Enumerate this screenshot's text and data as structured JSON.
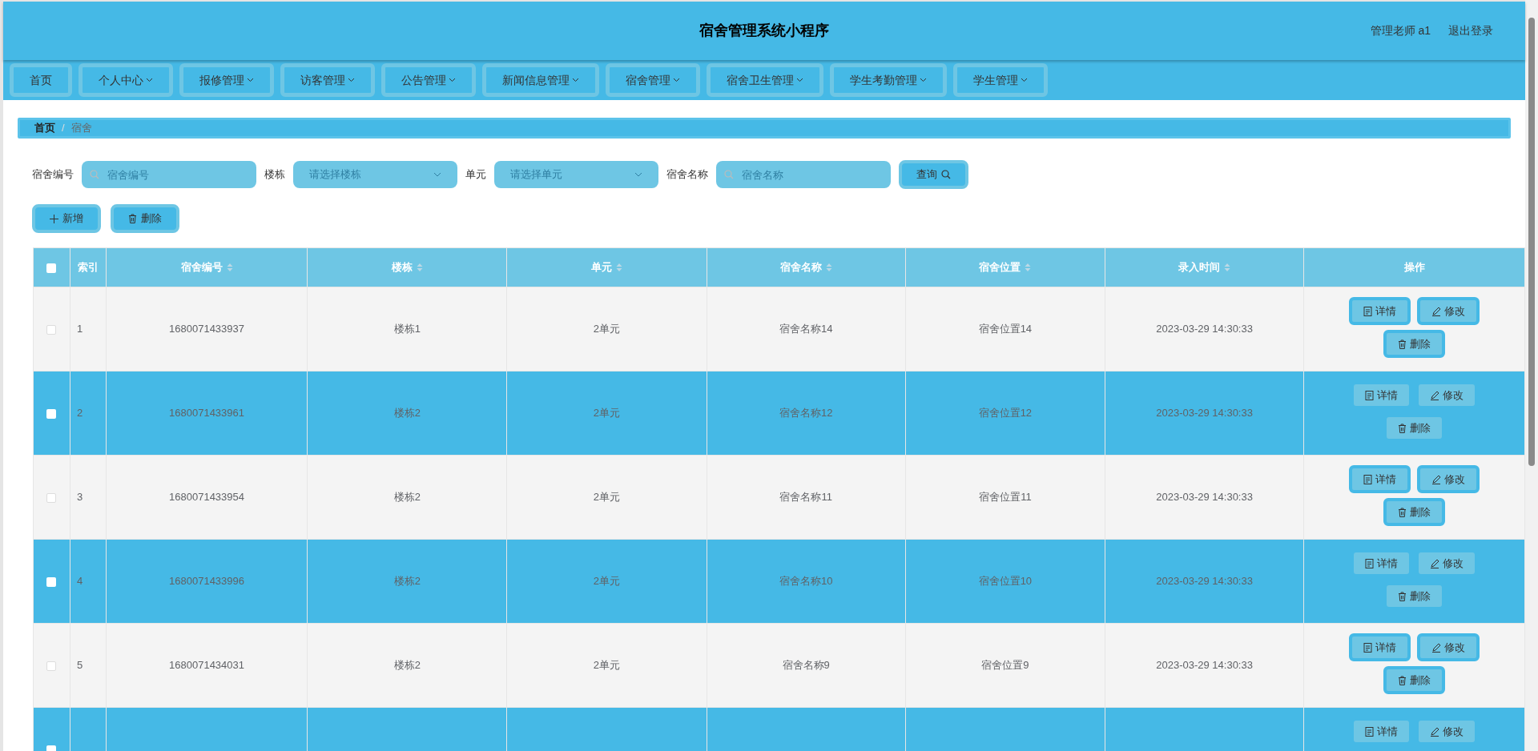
{
  "header": {
    "title": "宿舍管理系统小程序",
    "user": "管理老师 a1",
    "logout": "退出登录"
  },
  "nav": [
    {
      "label": "首页",
      "has_menu": false
    },
    {
      "label": "个人中心",
      "has_menu": true
    },
    {
      "label": "报修管理",
      "has_menu": true
    },
    {
      "label": "访客管理",
      "has_menu": true
    },
    {
      "label": "公告管理",
      "has_menu": true
    },
    {
      "label": "新闻信息管理",
      "has_menu": true
    },
    {
      "label": "宿舍管理",
      "has_menu": true
    },
    {
      "label": "宿舍卫生管理",
      "has_menu": true
    },
    {
      "label": "学生考勤管理",
      "has_menu": true
    },
    {
      "label": "学生管理",
      "has_menu": true
    }
  ],
  "breadcrumb": {
    "items": [
      "首页",
      "宿舍"
    ],
    "separator": "/"
  },
  "select_all_checked": false,
  "filters": [
    {
      "kind": "search",
      "label": "宿舍编号",
      "placeholder": "宿舍编号"
    },
    {
      "kind": "select",
      "label": "楼栋",
      "placeholder": "请选择楼栋"
    },
    {
      "kind": "select",
      "label": "单元",
      "placeholder": "请选择单元"
    },
    {
      "kind": "search",
      "label": "宿舍名称",
      "placeholder": "宿舍名称"
    }
  ],
  "query_button": "查询",
  "actions": [
    {
      "kind": "add",
      "label": "新增"
    },
    {
      "kind": "delete",
      "label": "删除"
    }
  ],
  "table": {
    "columns": [
      {
        "label": "索引",
        "sortable": false
      },
      {
        "label": "宿舍编号",
        "sortable": true
      },
      {
        "label": "楼栋",
        "sortable": true
      },
      {
        "label": "单元",
        "sortable": true
      },
      {
        "label": "宿舍名称",
        "sortable": true
      },
      {
        "label": "宿舍位置",
        "sortable": true
      },
      {
        "label": "录入时间",
        "sortable": true
      },
      {
        "label": "操作",
        "sortable": false
      }
    ],
    "rows": [
      {
        "checked": false,
        "cells": [
          "1",
          "1680071433937",
          "楼栋1",
          "2单元",
          "宿舍名称14",
          "宿舍位置14",
          "2023-03-29 14:30:33"
        ],
        "buttons": [
          "详情",
          "修改",
          "删除"
        ]
      },
      {
        "checked": false,
        "cells": [
          "2",
          "1680071433961",
          "楼栋2",
          "2单元",
          "宿舍名称12",
          "宿舍位置12",
          "2023-03-29 14:30:33"
        ],
        "buttons": [
          "详情",
          "修改",
          "删除"
        ]
      },
      {
        "checked": false,
        "cells": [
          "3",
          "1680071433954",
          "楼栋2",
          "2单元",
          "宿舍名称11",
          "宿舍位置11",
          "2023-03-29 14:30:33"
        ],
        "buttons": [
          "详情",
          "修改",
          "删除"
        ]
      },
      {
        "checked": false,
        "cells": [
          "4",
          "1680071433996",
          "楼栋2",
          "2单元",
          "宿舍名称10",
          "宿舍位置10",
          "2023-03-29 14:30:33"
        ],
        "buttons": [
          "详情",
          "修改",
          "删除"
        ]
      },
      {
        "checked": false,
        "cells": [
          "5",
          "1680071434031",
          "楼栋2",
          "2单元",
          "宿舍名称9",
          "宿舍位置9",
          "2023-03-29 14:30:33"
        ],
        "buttons": [
          "详情",
          "修改",
          "删除"
        ]
      },
      {
        "checked": false,
        "cells": [],
        "buttons": [
          "详情",
          "修改"
        ]
      }
    ]
  }
}
